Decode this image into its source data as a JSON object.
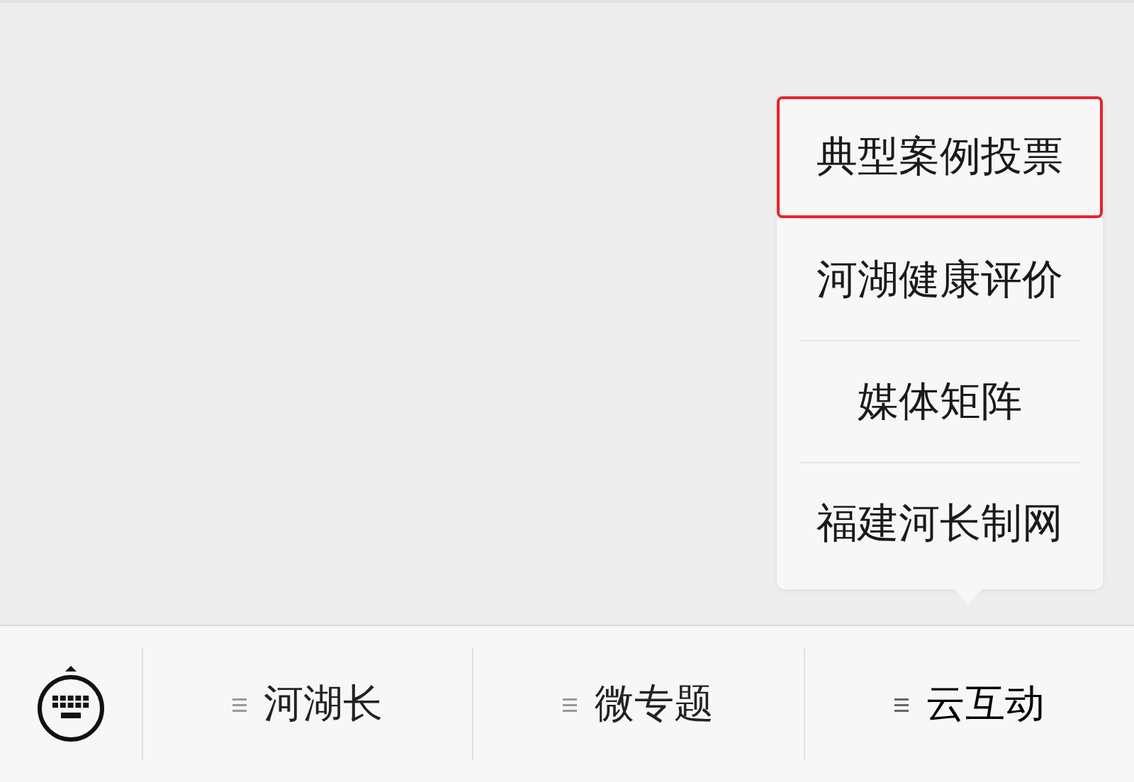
{
  "popup_menu": {
    "items": [
      {
        "label": "典型案例投票",
        "selected": true
      },
      {
        "label": "河湖健康评价",
        "selected": false
      },
      {
        "label": "媒体矩阵",
        "selected": false
      },
      {
        "label": "福建河长制网",
        "selected": false
      }
    ]
  },
  "bottom_menu": {
    "tabs": [
      {
        "label": "河湖长",
        "expanded": false
      },
      {
        "label": "微专题",
        "expanded": false
      },
      {
        "label": "云互动",
        "expanded": true
      }
    ]
  }
}
